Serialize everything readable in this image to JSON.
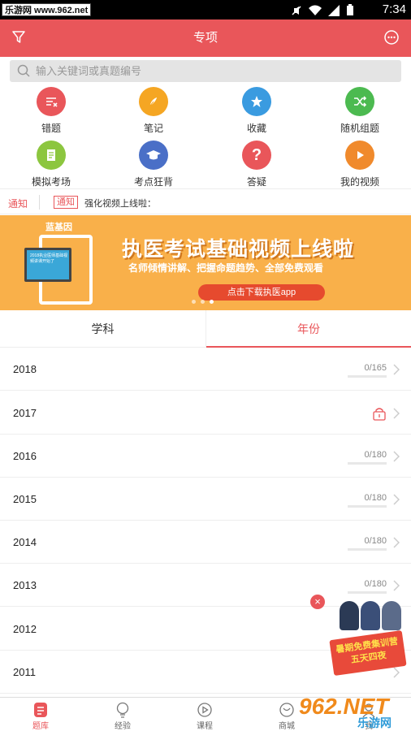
{
  "status_bar": {
    "watermark_text": "乐游网 www.962.net",
    "time": "7:34"
  },
  "app_bar": {
    "title": "专项",
    "filter_icon": "filter-icon",
    "chat_icon": "chat-icon"
  },
  "search": {
    "placeholder": "输入关键词或真题编号"
  },
  "grid": [
    {
      "label": "错题",
      "icon": "wrong-questions-icon",
      "color": "#e9565a"
    },
    {
      "label": "笔记",
      "icon": "note-icon",
      "color": "#f5a623"
    },
    {
      "label": "收藏",
      "icon": "star-icon",
      "color": "#3a9be0"
    },
    {
      "label": "随机组题",
      "icon": "shuffle-icon",
      "color": "#4cba50"
    },
    {
      "label": "模拟考场",
      "icon": "exam-icon",
      "color": "#8cc63f"
    },
    {
      "label": "考点狂背",
      "icon": "graduation-icon",
      "color": "#4a6fc7"
    },
    {
      "label": "答疑",
      "icon": "question-icon",
      "color": "#e9565a"
    },
    {
      "label": "我的视频",
      "icon": "play-icon",
      "color": "#f08a2c"
    }
  ],
  "notice": {
    "label": "通知",
    "tag": "通知",
    "text": "强化视频上线啦："
  },
  "banner": {
    "logo": "蓝基因",
    "headline": "执医考试基础视频上线啦",
    "sub": "名师倾情讲解、把握命题趋势、全部免费观看",
    "button": "点击下载执医app",
    "screen_text": "2018执业医师基础视频讲课开始了"
  },
  "tabs": [
    {
      "label": "学科",
      "active": false
    },
    {
      "label": "年份",
      "active": true
    }
  ],
  "years": [
    {
      "year": "2018",
      "count": "0/165",
      "locked": false,
      "progress": 0
    },
    {
      "year": "2017",
      "count": "",
      "locked": true,
      "progress": 0
    },
    {
      "year": "2016",
      "count": "0/180",
      "locked": false,
      "progress": 0
    },
    {
      "year": "2015",
      "count": "0/180",
      "locked": false,
      "progress": 0
    },
    {
      "year": "2014",
      "count": "0/180",
      "locked": false,
      "progress": 0
    },
    {
      "year": "2013",
      "count": "0/180",
      "locked": false,
      "progress": 0
    },
    {
      "year": "2012",
      "count": "",
      "locked": false,
      "progress": 0
    },
    {
      "year": "2011",
      "count": "",
      "locked": false,
      "progress": 0
    }
  ],
  "promo": {
    "line1": "暑期免费集训营",
    "line2": "五天四夜"
  },
  "tabbar": [
    {
      "label": "题库",
      "icon": "question-bank-icon",
      "active": true
    },
    {
      "label": "经验",
      "icon": "bulb-icon",
      "active": false
    },
    {
      "label": "课程",
      "icon": "course-play-icon",
      "active": false
    },
    {
      "label": "商城",
      "icon": "shop-icon",
      "active": false
    },
    {
      "label": "我",
      "icon": "profile-icon",
      "active": false
    }
  ],
  "site_watermark": {
    "number": "962.NET",
    "cn": "乐游网"
  },
  "colors": {
    "primary": "#e9565a",
    "banner": "#f9b04a"
  }
}
